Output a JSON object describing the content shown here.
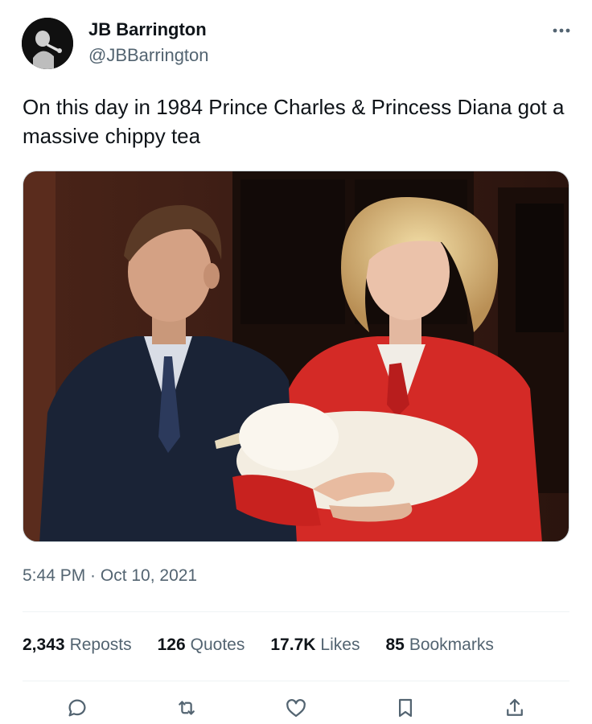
{
  "tweet": {
    "author": {
      "display_name": "JB Barrington",
      "handle": "@JBBarrington",
      "avatar_icon": "avatar-photo"
    },
    "more_icon": "more-dots-icon",
    "text": "On this day in 1984 Prince Charles & Princess Diana got a massive chippy tea",
    "timestamp": "5:44 PM · Oct 10, 2021",
    "stats": {
      "reposts": {
        "count": "2,343",
        "label": "Reposts"
      },
      "quotes": {
        "count": "126",
        "label": "Quotes"
      },
      "likes": {
        "count": "17.7K",
        "label": "Likes"
      },
      "bookmarks": {
        "count": "85",
        "label": "Bookmarks"
      }
    },
    "actions": [
      "reply-icon",
      "repost-icon",
      "like-icon",
      "bookmark-icon",
      "share-icon"
    ]
  },
  "colors": {
    "text_primary": "#0f1419",
    "text_secondary": "#536471",
    "divider": "#eff3f4"
  }
}
